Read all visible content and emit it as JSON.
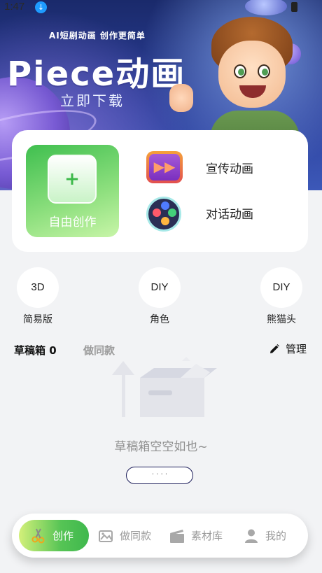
{
  "status_bar": {
    "time": "1:47"
  },
  "hero": {
    "tagline": "AI短剧动画 创作更简单",
    "title": "Piece动画",
    "cta": "立即下载"
  },
  "create": {
    "free_create": {
      "plus": "+",
      "label": "自由创作"
    },
    "types": [
      {
        "label": "宣传动画",
        "icon": "promo-video-icon"
      },
      {
        "label": "对话动画",
        "icon": "dialog-icon"
      }
    ]
  },
  "quick_actions": [
    {
      "badge": "3D",
      "label": "简易版"
    },
    {
      "badge": "DIY",
      "label": "角色"
    },
    {
      "badge": "DIY",
      "label": "熊猫头"
    }
  ],
  "drafts": {
    "tab_active": "草稿箱 0",
    "tab_inactive": "做同款",
    "manage_label": "管理",
    "empty_text": "草稿箱空空如也~",
    "empty_button": "· · · ·"
  },
  "bottom_nav": [
    {
      "label": "创作",
      "icon": "scissors-icon",
      "active": true
    },
    {
      "label": "做同款",
      "icon": "gallery-icon",
      "active": false
    },
    {
      "label": "素材库",
      "icon": "clapperboard-icon",
      "active": false
    },
    {
      "label": "我的",
      "icon": "user-icon",
      "active": false
    }
  ],
  "colors": {
    "accent_green": "#3fb84d",
    "hero_blue": "#2c3f9a"
  }
}
